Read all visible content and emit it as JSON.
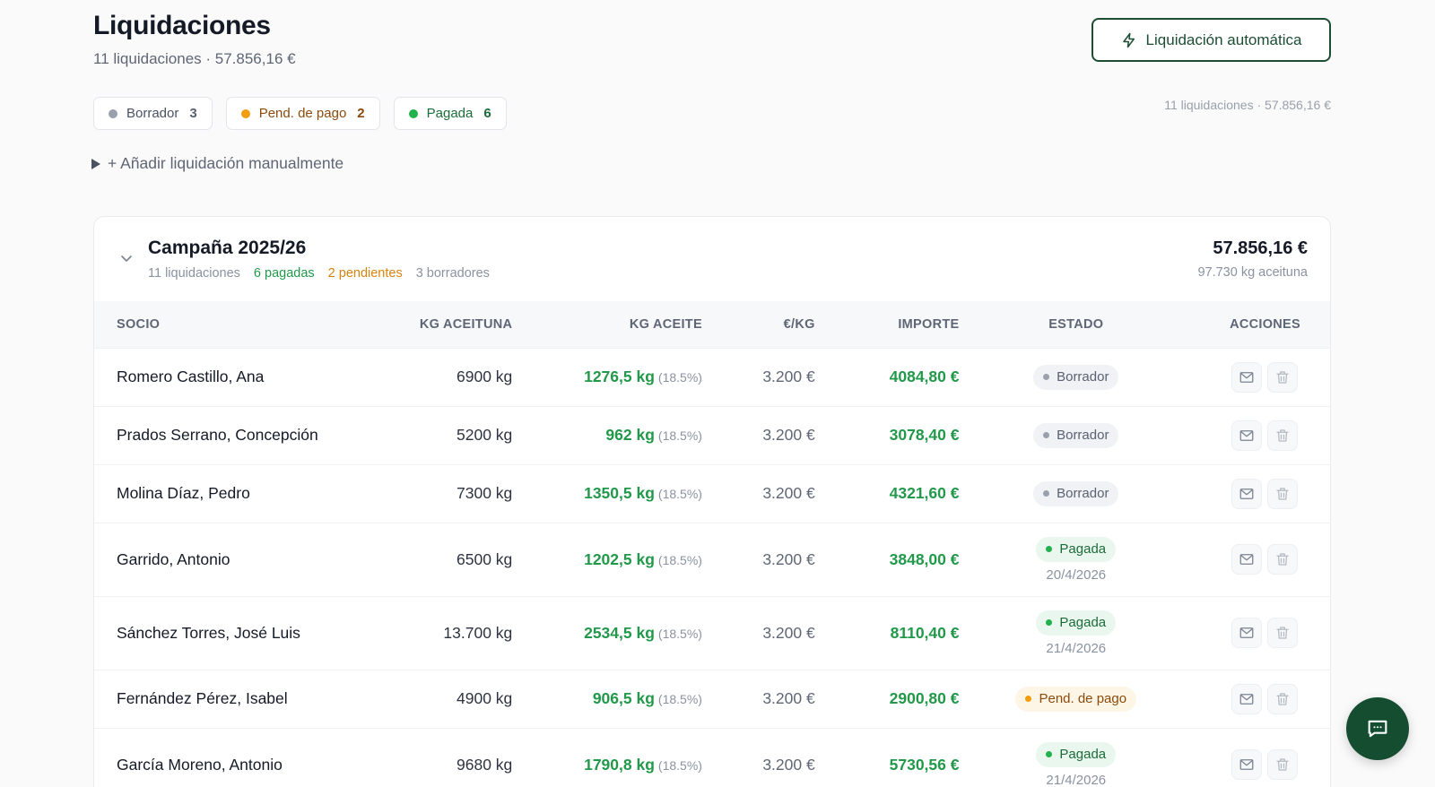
{
  "header": {
    "title": "Liquidaciones",
    "subtitle": "11 liquidaciones · 57.856,16 €"
  },
  "auto_button": {
    "label": "Liquidación automática",
    "icon": "lightning-icon"
  },
  "filters": [
    {
      "label": "Borrador",
      "count": "3"
    },
    {
      "label": "Pend. de pago",
      "count": "2"
    },
    {
      "label": "Pagada",
      "count": "6"
    }
  ],
  "summary_right": "11 liquidaciones · 57.856,16 €",
  "add_manual": "+ Añadir liquidación manualmente",
  "campaign": {
    "title": "Campaña 2025/26",
    "stats": {
      "total": "11 liquidaciones",
      "paid": "6 pagadas",
      "pending": "2 pendientes",
      "drafts": "3 borradores"
    },
    "amount": "57.856,16 €",
    "kg": "97.730 kg aceituna"
  },
  "table": {
    "columns": {
      "socio": "SOCIO",
      "kg_aceituna": "KG ACEITUNA",
      "kg_aceite": "KG ACEITE",
      "eur_kg": "€/KG",
      "importe": "IMPORTE",
      "estado": "ESTADO",
      "acciones": "ACCIONES"
    },
    "rows": [
      {
        "socio": "Romero Castillo, Ana",
        "kg_aceituna": "6900 kg",
        "kg_aceite": "1276,5 kg",
        "pct": "(18.5%)",
        "eur_kg": "3.200 €",
        "importe": "4084,80 €",
        "estado": "Borrador",
        "fecha": ""
      },
      {
        "socio": "Prados Serrano, Concepción",
        "kg_aceituna": "5200 kg",
        "kg_aceite": "962 kg",
        "pct": "(18.5%)",
        "eur_kg": "3.200 €",
        "importe": "3078,40 €",
        "estado": "Borrador",
        "fecha": ""
      },
      {
        "socio": "Molina Díaz, Pedro",
        "kg_aceituna": "7300 kg",
        "kg_aceite": "1350,5 kg",
        "pct": "(18.5%)",
        "eur_kg": "3.200 €",
        "importe": "4321,60 €",
        "estado": "Borrador",
        "fecha": ""
      },
      {
        "socio": "Garrido, Antonio",
        "kg_aceituna": "6500 kg",
        "kg_aceite": "1202,5 kg",
        "pct": "(18.5%)",
        "eur_kg": "3.200 €",
        "importe": "3848,00 €",
        "estado": "Pagada",
        "fecha": "20/4/2026"
      },
      {
        "socio": "Sánchez Torres, José Luis",
        "kg_aceituna": "13.700 kg",
        "kg_aceite": "2534,5 kg",
        "pct": "(18.5%)",
        "eur_kg": "3.200 €",
        "importe": "8110,40 €",
        "estado": "Pagada",
        "fecha": "21/4/2026"
      },
      {
        "socio": "Fernández Pérez, Isabel",
        "kg_aceituna": "4900 kg",
        "kg_aceite": "906,5 kg",
        "pct": "(18.5%)",
        "eur_kg": "3.200 €",
        "importe": "2900,80 €",
        "estado": "Pend. de pago",
        "fecha": ""
      },
      {
        "socio": "García Moreno, Antonio",
        "kg_aceituna": "9680 kg",
        "kg_aceite": "1790,8 kg",
        "pct": "(18.5%)",
        "eur_kg": "3.200 €",
        "importe": "5730,56 €",
        "estado": "Pagada",
        "fecha": "21/4/2026"
      }
    ]
  },
  "icons": {
    "mail": "mail-icon",
    "trash": "trash-icon",
    "chat": "chat-icon",
    "chevron": "chevron-down-icon"
  },
  "colors": {
    "brand": "#1c4d32",
    "green": "#22994a",
    "amber": "#f29e0c",
    "gray": "#9aa1ad"
  }
}
